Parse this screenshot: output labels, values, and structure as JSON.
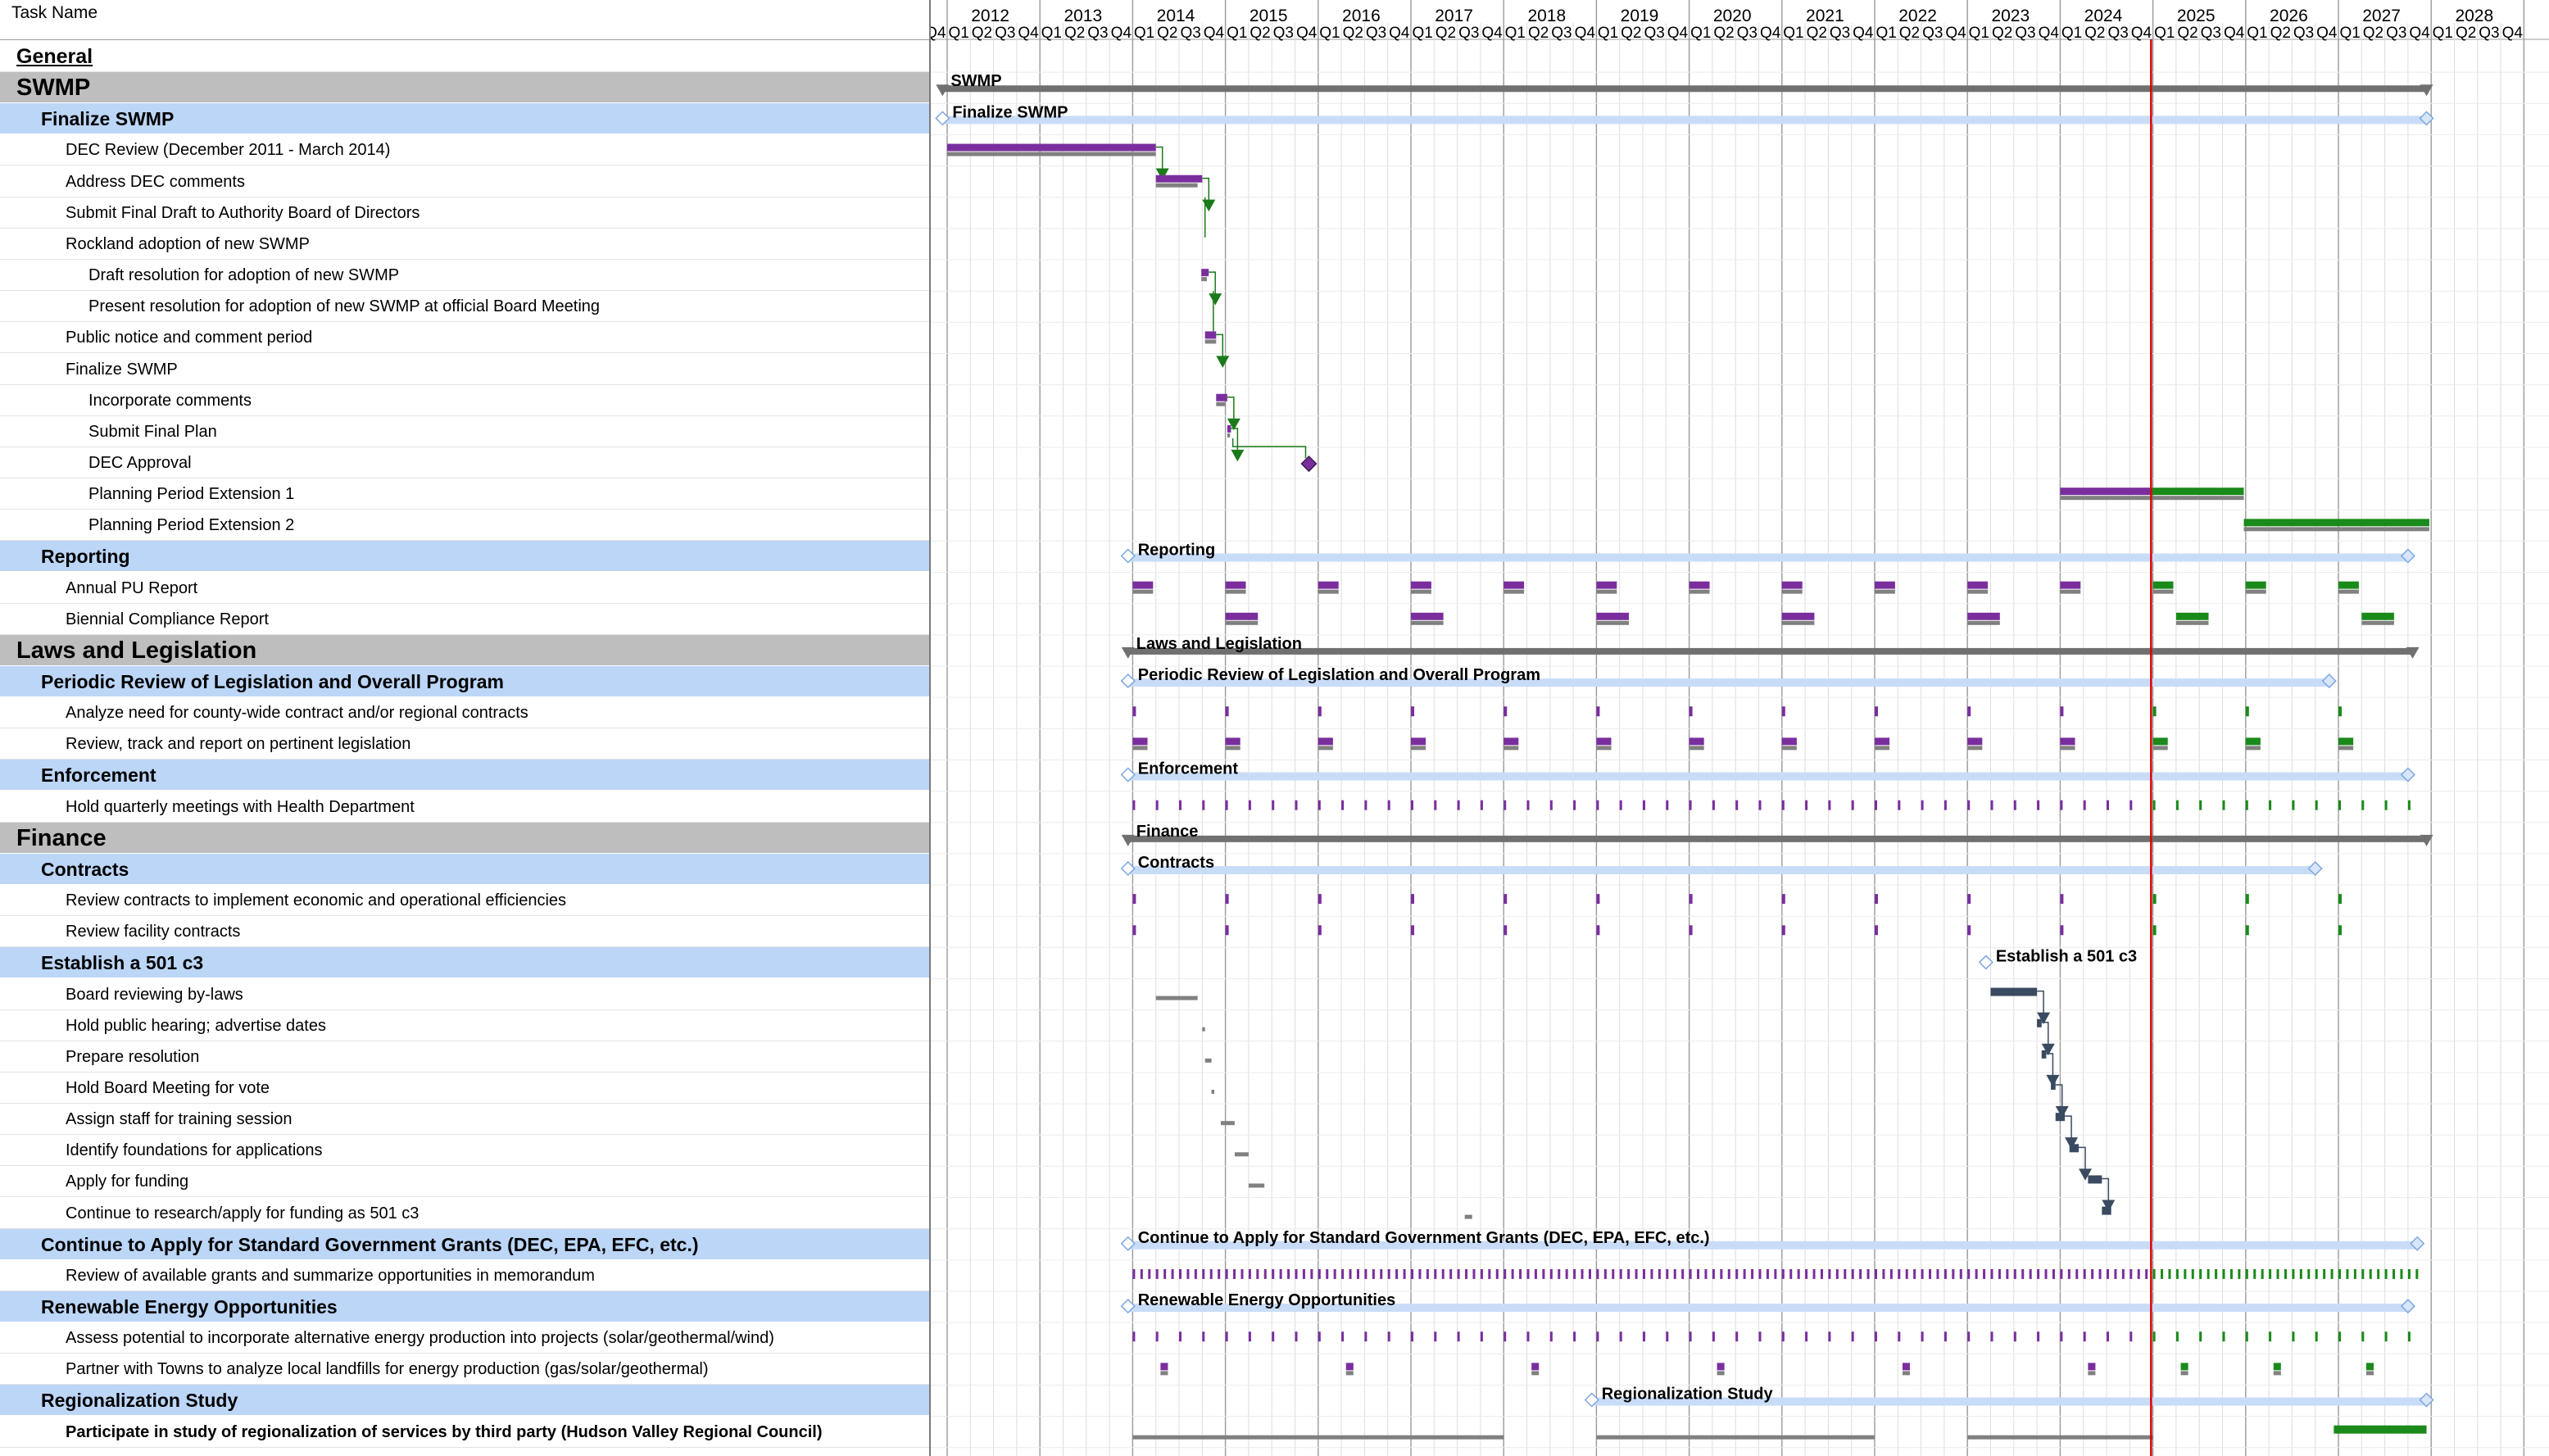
{
  "header": {
    "task_name": "Task Name"
  },
  "timeline": {
    "years": [
      "2012",
      "2013",
      "2014",
      "2015",
      "2016",
      "2017",
      "2018",
      "2019",
      "2020",
      "2021",
      "2022",
      "2023",
      "2024",
      "2025",
      "2026",
      "2027",
      "2028"
    ],
    "quarter_labels": [
      "Q4",
      "Q1",
      "Q2",
      "Q3",
      "Q4",
      "Q1",
      "Q2",
      "Q3",
      "Q4",
      "Q1",
      "Q2",
      "Q3",
      "Q4",
      "Q1",
      "Q2",
      "Q3",
      "Q4",
      "Q1",
      "Q2",
      "Q3",
      "Q4",
      "Q1",
      "Q2",
      "Q3",
      "Q4",
      "Q1",
      "Q2",
      "Q3",
      "Q4",
      "Q1",
      "Q2",
      "Q3",
      "Q4",
      "Q1",
      "Q2",
      "Q3",
      "Q4",
      "Q1",
      "Q2",
      "Q3",
      "Q4",
      "Q1",
      "Q2",
      "Q3",
      "Q4",
      "Q1",
      "Q2",
      "Q3",
      "Q4",
      "Q1",
      "Q2",
      "Q3",
      "Q4",
      "Q1",
      "Q2",
      "Q3",
      "Q4",
      "Q1",
      "Q2",
      "Q3",
      "Q4",
      "Q1",
      "Q2",
      "Q3",
      "Q4",
      "Q1",
      "Q2",
      "Q3",
      "Q4"
    ],
    "status_date": 2024.98
  },
  "colors": {
    "summary_row": "#bcd6f7",
    "major_row": "#bebebe",
    "actual_bar": "#7a2e9e",
    "future_bar": "#1a8a1a",
    "baseline_bar": "#808080",
    "summary_bar": "#c9dcf7",
    "major_bar": "#707070",
    "milestone": "#4a5e7a",
    "link": "#1a7a1a",
    "status_line": "#e00000"
  },
  "tasks": [
    {
      "name": "General",
      "kind": "general",
      "indent": 0
    },
    {
      "name": "SWMP",
      "kind": "major",
      "indent": 0,
      "bar_label": "SWMP",
      "start": 2011.95,
      "end": 2027.95
    },
    {
      "name": "Finalize SWMP",
      "kind": "summary",
      "indent": 1,
      "bar_label": "Finalize SWMP",
      "start": 2011.95,
      "end": 2027.95
    },
    {
      "name": "DEC Review (December 2011 - March 2014)",
      "kind": "task",
      "indent": 2,
      "start": 2012.0,
      "end": 2014.25,
      "base_start": 2012.0,
      "base_end": 2014.25
    },
    {
      "name": "Address DEC comments",
      "kind": "task",
      "indent": 2,
      "start": 2014.25,
      "end": 2014.75,
      "base_start": 2014.25,
      "base_end": 2014.7
    },
    {
      "name": "Submit Final Draft to Authority Board of Directors",
      "kind": "milestone-link",
      "indent": 2,
      "at": 2014.78
    },
    {
      "name": "Rockland adoption of new SWMP",
      "kind": "text",
      "indent": 2
    },
    {
      "name": "Draft resolution for adoption of new SWMP",
      "kind": "task",
      "indent": 3,
      "start": 2014.74,
      "end": 2014.82,
      "base_start": 2014.74,
      "base_end": 2014.8
    },
    {
      "name": "Present resolution for adoption of new SWMP at official Board Meeting",
      "kind": "milestone-link",
      "indent": 3,
      "at": 2014.87
    },
    {
      "name": "Public notice and comment period",
      "kind": "task",
      "indent": 2,
      "start": 2014.78,
      "end": 2014.9,
      "base_start": 2014.78,
      "base_end": 2014.9
    },
    {
      "name": "Finalize SWMP",
      "kind": "text",
      "indent": 2
    },
    {
      "name": "Incorporate comments",
      "kind": "task",
      "indent": 3,
      "start": 2014.9,
      "end": 2015.02,
      "base_start": 2014.9,
      "base_end": 2015.0
    },
    {
      "name": "Submit Final Plan",
      "kind": "task",
      "indent": 3,
      "start": 2015.02,
      "end": 2015.06,
      "base_start": 2015.02,
      "base_end": 2015.05
    },
    {
      "name": "DEC Approval",
      "kind": "diamond",
      "indent": 3,
      "at": 2015.9
    },
    {
      "name": "Planning Period Extension 1",
      "kind": "split",
      "indent": 3,
      "start": 2024.0,
      "mid": 2024.98,
      "end": 2025.98,
      "base_start": 2024.0,
      "base_end": 2025.98
    },
    {
      "name": "Planning Period Extension 2",
      "kind": "future",
      "indent": 3,
      "start": 2025.98,
      "end": 2027.98,
      "base_start": 2025.98,
      "base_end": 2027.98
    },
    {
      "name": "Reporting",
      "kind": "summary",
      "indent": 1,
      "bar_label": "Reporting",
      "start": 2013.95,
      "end": 2027.75
    },
    {
      "name": "Annual PU Report",
      "kind": "recur",
      "indent": 2,
      "starts": [
        2014.0,
        2015.0,
        2016.0,
        2017.0,
        2018.0,
        2019.0,
        2020.0,
        2021.0,
        2022.0,
        2023.0,
        2024.0,
        2025.0,
        2026.0,
        2027.0
      ],
      "dur": 0.22
    },
    {
      "name": "Biennial Compliance Report",
      "kind": "recur",
      "indent": 2,
      "starts": [
        2015.0,
        2017.0,
        2019.0,
        2021.0,
        2023.0,
        2025.25,
        2027.25
      ],
      "dur": 0.35
    },
    {
      "name": "Laws and Legislation",
      "kind": "major",
      "indent": 0,
      "bar_label": "Laws and Legislation",
      "start": 2013.95,
      "end": 2027.8
    },
    {
      "name": "Periodic Review of Legislation and Overall Program",
      "kind": "summary",
      "indent": 1,
      "bar_label": "Periodic Review of Legislation and Overall Program",
      "start": 2013.95,
      "end": 2026.9
    },
    {
      "name": "Analyze need for county-wide contract and/or regional contracts",
      "kind": "ticks",
      "indent": 2,
      "starts": [
        2014.0,
        2015.0,
        2016.0,
        2017.0,
        2018.0,
        2019.0,
        2020.0,
        2021.0,
        2022.0,
        2023.0,
        2024.0,
        2025.0,
        2026.0,
        2027.0
      ],
      "dur": 0.05
    },
    {
      "name": "Review, track and report on pertinent legislation",
      "kind": "recur",
      "indent": 2,
      "starts": [
        2014.0,
        2015.0,
        2016.0,
        2017.0,
        2018.0,
        2019.0,
        2020.0,
        2021.0,
        2022.0,
        2023.0,
        2024.0,
        2025.0,
        2026.0,
        2027.0
      ],
      "dur": 0.16
    },
    {
      "name": "Enforcement",
      "kind": "summary",
      "indent": 1,
      "bar_label": "Enforcement",
      "start": 2013.95,
      "end": 2027.75
    },
    {
      "name": "Hold quarterly meetings with Health Department",
      "kind": "quarterly",
      "indent": 2,
      "start": 2014.0,
      "end": 2027.75
    },
    {
      "name": "Finance",
      "kind": "major",
      "indent": 0,
      "bar_label": "Finance",
      "start": 2013.95,
      "end": 2027.95
    },
    {
      "name": "Contracts",
      "kind": "summary",
      "indent": 1,
      "bar_label": "Contracts",
      "start": 2013.95,
      "end": 2026.75
    },
    {
      "name": "Review contracts to implement economic and operational efficiencies",
      "kind": "ticks",
      "indent": 2,
      "starts": [
        2014.0,
        2015.0,
        2016.0,
        2017.0,
        2018.0,
        2019.0,
        2020.0,
        2021.0,
        2022.0,
        2023.0,
        2024.0,
        2025.0,
        2026.0,
        2027.0
      ],
      "dur": 0.05
    },
    {
      "name": "Review facility contracts",
      "kind": "ticks",
      "indent": 2,
      "starts": [
        2014.0,
        2015.0,
        2016.0,
        2017.0,
        2018.0,
        2019.0,
        2020.0,
        2021.0,
        2022.0,
        2023.0,
        2024.0,
        2025.0,
        2026.0,
        2027.0
      ],
      "dur": 0.04
    },
    {
      "name": "Establish a 501 c3",
      "kind": "summary",
      "indent": 1,
      "bar_label": "Establish a 501 c3",
      "start": 2023.2,
      "end": 2023.2
    },
    {
      "name": "Board reviewing by-laws",
      "kind": "chain",
      "indent": 2,
      "start": 2023.25,
      "end": 2023.75,
      "base_start": 2014.25,
      "base_end": 2014.7
    },
    {
      "name": "Hold public hearing; advertise dates",
      "kind": "chain",
      "indent": 2,
      "start": 2023.75,
      "end": 2023.8,
      "base_start": 2014.75,
      "base_end": 2014.78
    },
    {
      "name": "Prepare resolution",
      "kind": "chain",
      "indent": 2,
      "start": 2023.8,
      "end": 2023.85,
      "base_start": 2014.78,
      "base_end": 2014.85
    },
    {
      "name": "Hold Board Meeting for vote",
      "kind": "chain",
      "indent": 2,
      "start": 2023.9,
      "end": 2023.95,
      "base_start": 2014.85,
      "base_end": 2014.88
    },
    {
      "name": "Assign staff for training session",
      "kind": "chain",
      "indent": 2,
      "start": 2023.95,
      "end": 2024.05,
      "base_start": 2014.95,
      "base_end": 2015.1
    },
    {
      "name": "Identify foundations for applications",
      "kind": "chain",
      "indent": 2,
      "start": 2024.1,
      "end": 2024.2,
      "base_start": 2015.1,
      "base_end": 2015.25
    },
    {
      "name": "Apply for funding",
      "kind": "chain",
      "indent": 2,
      "start": 2024.3,
      "end": 2024.45,
      "base_start": 2015.25,
      "base_end": 2015.42
    },
    {
      "name": "Continue to research/apply for funding as 501 c3",
      "kind": "chain-end",
      "indent": 2,
      "start": 2024.45,
      "end": 2024.55,
      "base_start": 2017.58,
      "base_end": 2017.66
    },
    {
      "name": "Continue to Apply for Standard Government Grants (DEC, EPA, EFC, etc.)",
      "kind": "summary",
      "indent": 1,
      "bar_label": "Continue to Apply for Standard Government Grants (DEC, EPA, EFC, etc.)",
      "start": 2013.95,
      "end": 2027.85
    },
    {
      "name": "Review of available grants and summarize opportunities in memorandum",
      "kind": "monthly",
      "indent": 2,
      "start": 2014.0,
      "end": 2027.85
    },
    {
      "name": "Renewable Energy Opportunities",
      "kind": "summary",
      "indent": 1,
      "bar_label": "Renewable Energy Opportunities",
      "start": 2013.95,
      "end": 2027.75
    },
    {
      "name": "Assess potential to incorporate alternative energy production into projects (solar/geothermal/wind)",
      "kind": "quarterly",
      "indent": 2,
      "start": 2014.0,
      "end": 2027.75
    },
    {
      "name": "Partner with Towns to analyze local landfills for energy production (gas/solar/geothermal)",
      "kind": "recur",
      "indent": 2,
      "starts": [
        2014.3,
        2016.3,
        2018.3,
        2020.3,
        2022.3,
        2024.3,
        2025.3,
        2026.3,
        2027.3
      ],
      "dur": 0.08
    },
    {
      "name": "Regionalization Study",
      "kind": "summary",
      "indent": 1,
      "bar_label": "Regionalization Study",
      "start": 2018.95,
      "end": 2027.95
    },
    {
      "name": "Participate in study of regionalization of services by third party (Hudson Valley Regional Council)",
      "kind": "regional",
      "indent": 2,
      "bold": true,
      "start": 2026.95,
      "end": 2027.95,
      "bases": [
        [
          2014.0,
          2018.0
        ],
        [
          2019.0,
          2022.0
        ],
        [
          2023.0,
          2025.0
        ]
      ]
    }
  ]
}
